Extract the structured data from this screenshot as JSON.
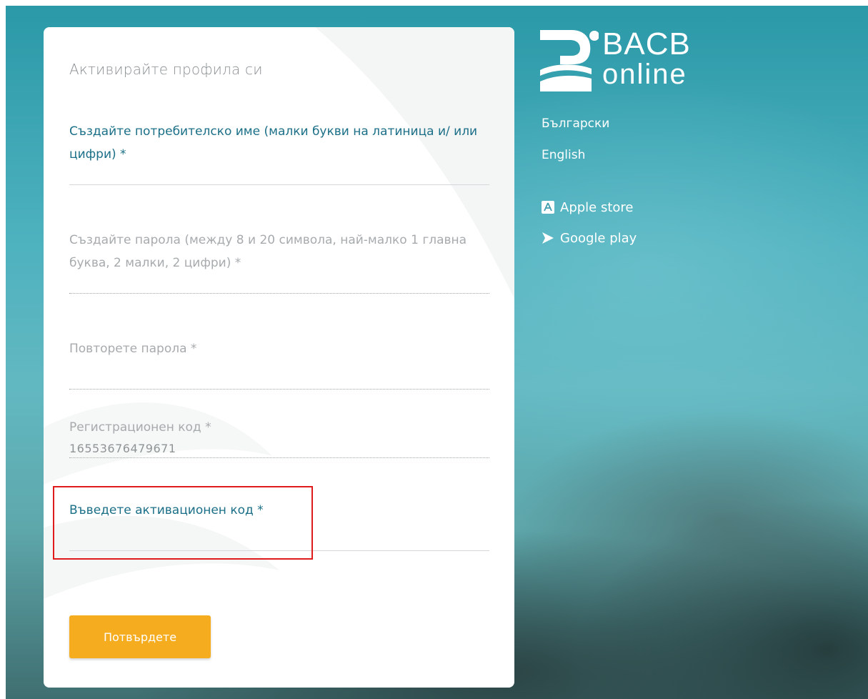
{
  "brand": {
    "logo_top": "BACB",
    "logo_bottom": "online"
  },
  "form": {
    "title": "Активирайте профила си",
    "username_label": "Създайте потребителско име (малки букви на латиница и/ или цифри) *",
    "username_value": "",
    "password_label": "Създайте парола (между 8 и 20 символа, най-малко 1 главна буква, 2 малки, 2 цифри) *",
    "password_value": "",
    "repeat_password_label": "Повторете парола *",
    "repeat_password_value": "",
    "registration_code_label": "Регистрационен код *",
    "registration_code_value": "16553676479671",
    "activation_code_label": "Въведете активационен код *",
    "activation_code_value": "",
    "submit_label": "Потвърдете"
  },
  "languages": {
    "bulgarian": "Български",
    "english": "English"
  },
  "stores": {
    "apple": "Apple store",
    "google": "Google play"
  },
  "colors": {
    "accent_button": "#f5ac1f",
    "active_label": "#1b6f87",
    "highlight": "#e01b1b"
  }
}
